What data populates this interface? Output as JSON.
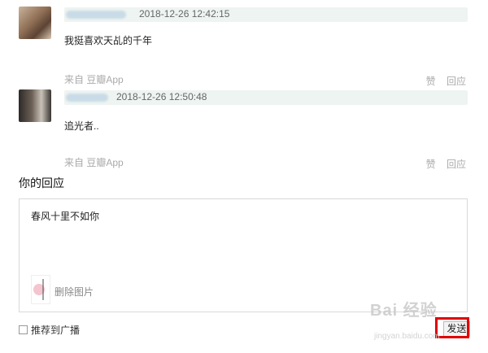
{
  "comments": [
    {
      "timestamp": "2018-12-26 12:42:15",
      "text": "我挺喜欢天乩的千年",
      "source": "来自 豆瓣App",
      "like_label": "赞",
      "reply_label": "回应"
    },
    {
      "timestamp": "2018-12-26 12:50:48",
      "text": "追光者..",
      "source": "来自 豆瓣App",
      "like_label": "赞",
      "reply_label": "回应"
    }
  ],
  "reply": {
    "title": "你的回应",
    "text": "春风十里不如你",
    "delete_image_label": "删除图片",
    "recommend_label": "推荐到广播",
    "send_label": "发送"
  },
  "watermark": {
    "main": "Bai 经验",
    "sub": "jingyan.baidu.com"
  },
  "colors": {
    "highlight": "#e00000",
    "meta_bar": "#eef4f1",
    "muted_text": "#aaaaaa"
  }
}
